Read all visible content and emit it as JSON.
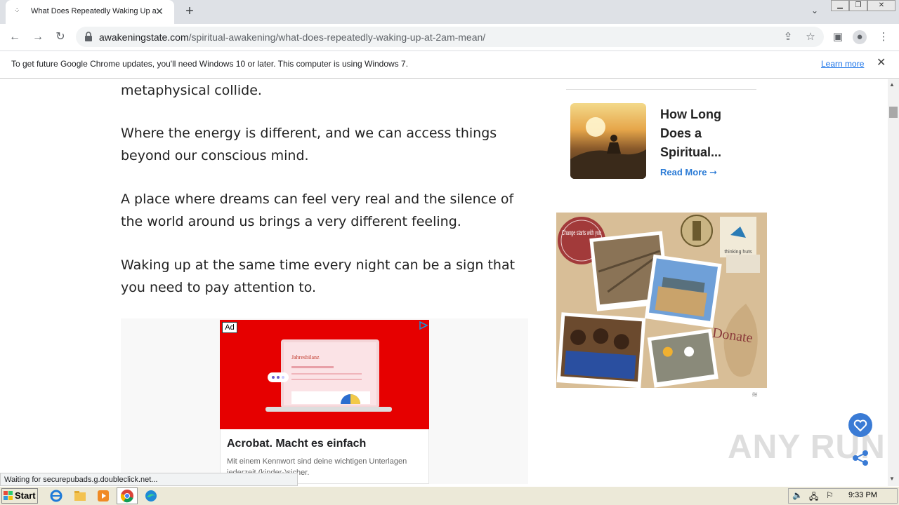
{
  "browser": {
    "tab_title": "What Does Repeatedly Waking Up a",
    "url_host": "awakeningstate.com",
    "url_path": "/spiritual-awakening/what-does-repeatedly-waking-up-at-2am-mean/",
    "infobar_text": "To get future Google Chrome updates, you'll need Windows 10 or later. This computer is using Windows 7.",
    "infobar_link": "Learn more",
    "status_text": "Waiting for securepubads.g.doubleclick.net..."
  },
  "article": {
    "paragraphs": [
      "metaphysical collide.",
      "Where the energy is different, and we can access things beyond our conscious mind.",
      "A place where dreams can feel very real and the silence of the world around us brings a very different feeling.",
      "Waking up at the same time every night can be a sign that you need to pay attention to."
    ]
  },
  "ad": {
    "badge": "Ad",
    "image_heading": "Jahresbilanz",
    "headline": "Acrobat. Macht es einfach",
    "body": "Mit einem Kennwort sind deine wichtigen Unterlagen jederzeit (kinder-)sicher."
  },
  "sidebar": {
    "related_title": "How Long Does a Spiritual...",
    "read_more": "Read More ➞"
  },
  "banner": {
    "badge_text": "Change starts with you",
    "brand": "thinking huts",
    "donate": "Donate"
  },
  "watermark": "ANY RUN",
  "taskbar": {
    "start_label": "Start",
    "clock": "9:33 PM"
  },
  "colors": {
    "accent": "#1a73e8",
    "read_more": "#2b7bd6",
    "ad_red": "#e60000",
    "fav_button": "#3a7bd5"
  }
}
